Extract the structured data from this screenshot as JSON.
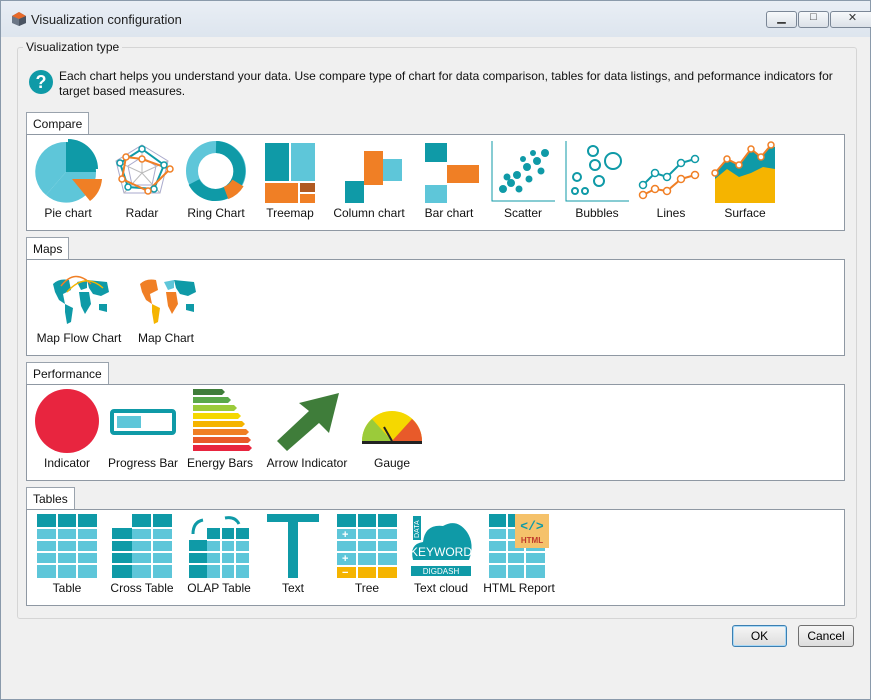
{
  "window": {
    "title": "Visualization configuration"
  },
  "group": {
    "label": "Visualization type"
  },
  "help": {
    "text": "Each chart helps you understand your data. Use compare type of chart for data comparison, tables for data listings, and peformance indicators for target based measures."
  },
  "sections": [
    {
      "tab": "Compare",
      "items": [
        "Pie chart",
        "Radar",
        "Ring Chart",
        "Treemap",
        "Column chart",
        "Bar chart",
        "Scatter",
        "Bubbles",
        "Lines",
        "Surface"
      ]
    },
    {
      "tab": "Maps",
      "items": [
        "Map Flow Chart",
        "Map Chart"
      ]
    },
    {
      "tab": "Performance",
      "items": [
        "Indicator",
        "Progress Bar",
        "Energy Bars",
        "Arrow Indicator",
        "Gauge"
      ]
    },
    {
      "tab": "Tables",
      "items": [
        "Table",
        "Cross Table",
        "OLAP Table",
        "Text",
        "Tree",
        "Text cloud",
        "HTML Report"
      ]
    }
  ],
  "icon_text": {
    "keyword": "KEYWORD",
    "digdash": "DIGDASH",
    "data": "DATA",
    "html": "HTML"
  },
  "buttons": {
    "ok": "OK",
    "cancel": "Cancel"
  },
  "colors": {
    "teal": "#0f9aa7",
    "light_teal": "#5ec6d9",
    "orange": "#f07f25",
    "red": "#e8253f",
    "green": "#3f7d3a"
  }
}
